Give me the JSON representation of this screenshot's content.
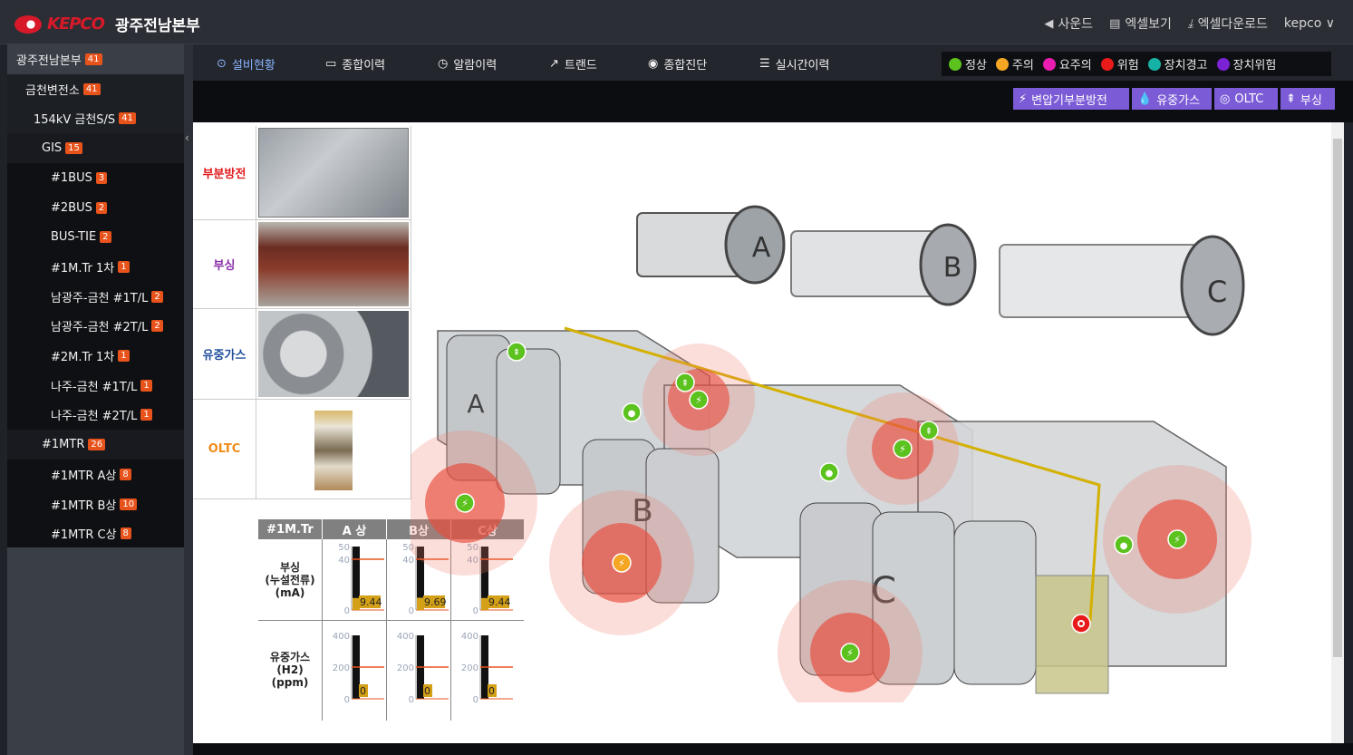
{
  "header": {
    "logo_text": "KEPCO",
    "org_name": "광주전남본부",
    "menu": [
      {
        "icon": "speaker-icon",
        "label": "사운드"
      },
      {
        "icon": "excel-view-icon",
        "label": "엑셀보기"
      },
      {
        "icon": "download-icon",
        "label": "엑셀다운로드"
      }
    ],
    "user": "kepco ∨"
  },
  "sidebar": {
    "items": [
      {
        "label": "광주전남본부",
        "badge": "41",
        "indent": 0
      },
      {
        "label": "금천변전소",
        "badge": "41",
        "indent": 1
      },
      {
        "label": "154kV 금천S/S",
        "badge": "41",
        "indent": 2
      },
      {
        "label": "GIS",
        "badge": "15",
        "indent": 3
      },
      {
        "label": "#1BUS",
        "badge": "3",
        "indent": 4
      },
      {
        "label": "#2BUS",
        "badge": "2",
        "indent": 4
      },
      {
        "label": "BUS-TIE",
        "badge": "2",
        "indent": 4
      },
      {
        "label": "#1M.Tr 1차",
        "badge": "1",
        "indent": 4
      },
      {
        "label": "남광주-금천 #1T/L",
        "badge": "2",
        "indent": 4
      },
      {
        "label": "남광주-금천 #2T/L",
        "badge": "2",
        "indent": 4
      },
      {
        "label": "#2M.Tr 1차",
        "badge": "1",
        "indent": 4
      },
      {
        "label": "나주-금천 #1T/L",
        "badge": "1",
        "indent": 4
      },
      {
        "label": "나주-금천 #2T/L",
        "badge": "1",
        "indent": 4
      },
      {
        "label": "#1MTR",
        "badge": "26",
        "indent": 3
      },
      {
        "label": "#1MTR A상",
        "badge": "8",
        "indent": 4
      },
      {
        "label": "#1MTR B상",
        "badge": "10",
        "indent": 4
      },
      {
        "label": "#1MTR C상",
        "badge": "8",
        "indent": 4
      }
    ]
  },
  "tabs": [
    {
      "icon": "location-pin-icon",
      "label": "설비현황",
      "active": true
    },
    {
      "icon": "history-chart-icon",
      "label": "종합이력",
      "active": false
    },
    {
      "icon": "clock-icon",
      "label": "알람이력",
      "active": false
    },
    {
      "icon": "trend-line-icon",
      "label": "트랜드",
      "active": false
    },
    {
      "icon": "diagnosis-icon",
      "label": "종합진단",
      "active": false
    },
    {
      "icon": "list-icon",
      "label": "실시간이력",
      "active": false
    }
  ],
  "status_legend": [
    {
      "label": "정상",
      "color": "#5cc21e"
    },
    {
      "label": "주의",
      "color": "#f5a623"
    },
    {
      "label": "요주의",
      "color": "#e91eb0"
    },
    {
      "label": "위험",
      "color": "#e81a1a"
    },
    {
      "label": "장치경고",
      "color": "#17b2a6"
    },
    {
      "label": "장치위험",
      "color": "#7b22d4"
    }
  ],
  "filter_buttons": [
    {
      "icon": "lightning-icon",
      "label": "변압기부분방전"
    },
    {
      "icon": "drop-icon",
      "label": "유중가스"
    },
    {
      "icon": "target-icon",
      "label": "OLTC"
    },
    {
      "icon": "bushing-icon",
      "label": "부싱"
    }
  ],
  "photo_rows": [
    {
      "label": "부분방전",
      "color": "#e01b1b"
    },
    {
      "label": "부싱",
      "color": "#8b2fa8"
    },
    {
      "label": "유중가스",
      "color": "#1f4e9c"
    },
    {
      "label": "OLTC",
      "color": "#f08c1a"
    }
  ],
  "measure_table": {
    "headers": [
      "#1M.Tr",
      "A 상",
      "B상",
      "C상"
    ],
    "rows": [
      {
        "label_lines": [
          "부싱",
          "(누설전류)",
          "(mA)"
        ]
      },
      {
        "label_lines": [
          "유중가스",
          "(H2)",
          "(ppm)"
        ]
      }
    ]
  },
  "chart_data": [
    {
      "type": "bar",
      "title": "부싱 (누설전류) (mA)",
      "categories": [
        "A 상",
        "B상",
        "C상"
      ],
      "values": [
        9.44,
        9.69,
        9.44
      ],
      "value_labels": [
        "9.44",
        "9.69",
        "9.44"
      ],
      "ylim": [
        0,
        50
      ],
      "yticks": [
        0,
        40,
        50
      ],
      "tick_labels": [
        "0",
        "40",
        "50"
      ],
      "threshold": 40,
      "threshold_color": "#e8531c"
    },
    {
      "type": "bar",
      "title": "유중가스 (H2) (ppm)",
      "categories": [
        "A 상",
        "B상",
        "C상"
      ],
      "values": [
        0,
        0,
        0
      ],
      "value_labels": [
        "0",
        "0",
        "0"
      ],
      "ylim": [
        0,
        400
      ],
      "yticks": [
        0,
        200,
        400
      ],
      "tick_labels": [
        "0",
        "200",
        "400"
      ],
      "threshold": 200,
      "threshold_color": "#e8531c"
    }
  ],
  "diagram": {
    "phase_labels": [
      "A",
      "B",
      "C"
    ]
  }
}
